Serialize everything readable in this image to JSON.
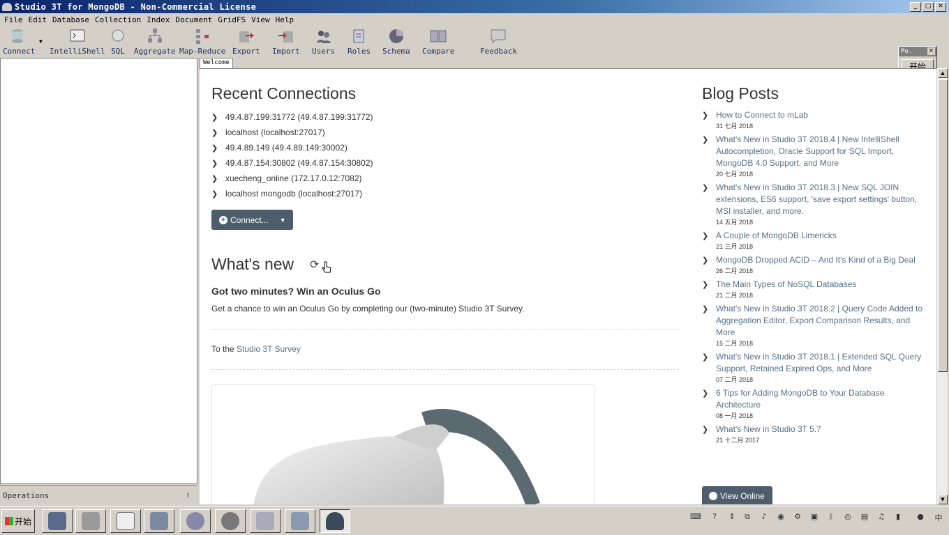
{
  "window": {
    "title": "Studio 3T for MongoDB - Non-Commercial License",
    "minimize_glyph": "_",
    "maximize_glyph": "□",
    "close_glyph": "✕"
  },
  "menu": [
    "File",
    "Edit",
    "Database",
    "Collection",
    "Index",
    "Document",
    "GridFS",
    "View",
    "Help"
  ],
  "toolbar": {
    "connect": "Connect",
    "intellishell": "IntelliShell",
    "sql": "SQL",
    "aggregate": "Aggregate",
    "map_reduce": "Map-Reduce",
    "export": "Export",
    "import": "Import",
    "users": "Users",
    "roles": "Roles",
    "schema": "Schema",
    "compare": "Compare",
    "feedback": "Feedback"
  },
  "left_panel": {
    "operations_label": "Operations"
  },
  "tabs": {
    "welcome": "Welcome"
  },
  "welcome": {
    "recent_connections_title": "Recent Connections",
    "connections": [
      "49.4.87.199:31772 (49.4.87.199:31772)",
      "localhost (localhost:27017)",
      "49.4.89.149 (49.4.89.149:30002)",
      "49.4.87.154:30802 (49.4.87.154:30802)",
      "xuecheng_online (172.17.0.12:7082)",
      "localhost mongodb (localhost:27017)"
    ],
    "connect_button": "Connect...",
    "whats_new_title": "What's new",
    "news_title": "Got two minutes? Win an Oculus Go",
    "news_body": "Get a chance to win an Oculus Go by completing our (two-minute) Studio 3T Survey.",
    "survey_prefix": "To the ",
    "survey_link": "Studio 3T Survey",
    "blog_title": "Blog Posts",
    "blog_posts": [
      {
        "title": "How to Connect to mLab",
        "date": "31 七月 2018"
      },
      {
        "title": "What's New in Studio 3T 2018.4 | New IntelliShell Autocompletion, Oracle Support for SQL Import, MongoDB 4.0 Support, and More",
        "date": "20 七月 2018"
      },
      {
        "title": "What's New in Studio 3T 2018.3 | New SQL JOIN extensions, ES6 support, 'save export settings' button, MSI installer, and more.",
        "date": "14 五月 2018"
      },
      {
        "title": "A Couple of MongoDB Limericks",
        "date": "21 三月 2018"
      },
      {
        "title": "MongoDB Dropped ACID – And It's Kind of a Big Deal",
        "date": "26 二月 2018"
      },
      {
        "title": "The Main Types of NoSQL Databases",
        "date": "21 二月 2018"
      },
      {
        "title": "What's New in Studio 3T 2018.2 | Query Code Added to Aggregation Editor, Export Comparison Results, and More",
        "date": "15 二月 2018"
      },
      {
        "title": "What's New in Studio 3T 2018.1 | Extended SQL Query Support, Retained Expired Ops, and More",
        "date": "07 二月 2018"
      },
      {
        "title": "6 Tips for Adding MongoDB to Your Database Architecture",
        "date": "08 一月 2018"
      },
      {
        "title": "What's New in Studio 3T 5.7",
        "date": "21 十二月 2017"
      }
    ],
    "view_online_button": "View Online"
  },
  "float_window": {
    "title": "Po.",
    "button": "开始"
  },
  "taskbar": {
    "start_label": "开始"
  },
  "colors": {
    "button_bg": "#4d5d6c",
    "link": "#53708a",
    "text": "#333333",
    "titlebar": "#0a246a"
  }
}
